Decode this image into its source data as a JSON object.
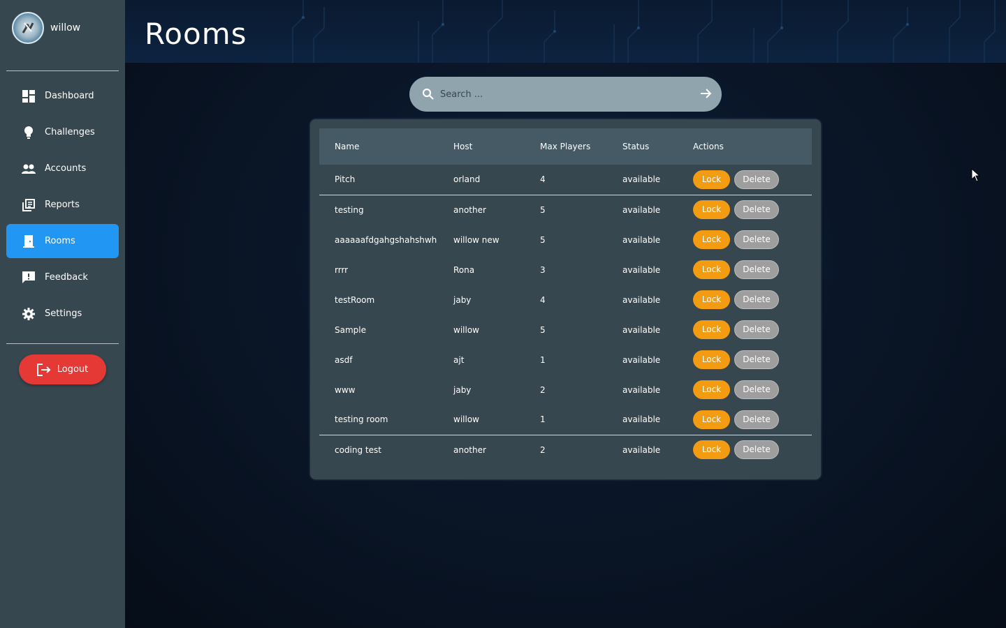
{
  "user": {
    "name": "willow"
  },
  "sidebar": {
    "items": [
      {
        "label": "Dashboard",
        "icon": "dashboard-icon",
        "active": false
      },
      {
        "label": "Challenges",
        "icon": "lightbulb-icon",
        "active": false
      },
      {
        "label": "Accounts",
        "icon": "people-icon",
        "active": false
      },
      {
        "label": "Reports",
        "icon": "library-books-icon",
        "active": false
      },
      {
        "label": "Rooms",
        "icon": "door-icon",
        "active": true
      },
      {
        "label": "Feedback",
        "icon": "feedback-icon",
        "active": false
      },
      {
        "label": "Settings",
        "icon": "gear-icon",
        "active": false
      }
    ],
    "logout_label": "Logout"
  },
  "header": {
    "title": "Rooms"
  },
  "search": {
    "placeholder": "Search ..."
  },
  "table": {
    "headers": [
      "Name",
      "Host",
      "Max Players",
      "Status",
      "Actions"
    ],
    "rows": [
      {
        "name": "Pitch",
        "host": "orland",
        "max_players": "4",
        "status": "available"
      },
      {
        "name": "testing",
        "host": "another",
        "max_players": "5",
        "status": "available"
      },
      {
        "name": "aaaaaafdgahgshahshwh",
        "host": "willow new",
        "max_players": "5",
        "status": "available"
      },
      {
        "name": "rrrr",
        "host": "Rona",
        "max_players": "3",
        "status": "available"
      },
      {
        "name": "testRoom",
        "host": "jaby",
        "max_players": "4",
        "status": "available"
      },
      {
        "name": "Sample",
        "host": "willow",
        "max_players": "5",
        "status": "available"
      },
      {
        "name": "asdf",
        "host": "ajt",
        "max_players": "1",
        "status": "available"
      },
      {
        "name": "www",
        "host": "jaby",
        "max_players": "2",
        "status": "available"
      },
      {
        "name": "testing room",
        "host": "willow",
        "max_players": "1",
        "status": "available"
      },
      {
        "name": "coding test",
        "host": "another",
        "max_players": "2",
        "status": "available"
      }
    ],
    "lock_label": "Lock",
    "delete_label": "Delete"
  },
  "colors": {
    "sidebar_bg": "#37474f",
    "active_nav": "#2196f3",
    "logout": "#e53935",
    "lock": "#f39c12",
    "delete": "#9e9e9e",
    "card_bg": "#37474f",
    "table_header_bg": "#455a64"
  }
}
